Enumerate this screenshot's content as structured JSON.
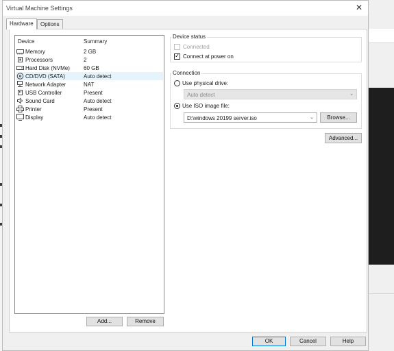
{
  "window": {
    "title": "Virtual Machine Settings",
    "close_glyph": "✕"
  },
  "tabs": [
    {
      "label": "Hardware",
      "active": true
    },
    {
      "label": "Options",
      "active": false
    }
  ],
  "device_table": {
    "columns": [
      "Device",
      "Summary"
    ],
    "rows": [
      {
        "icon": "memory-icon",
        "device": "Memory",
        "summary": "2 GB",
        "selected": false
      },
      {
        "icon": "processor-icon",
        "device": "Processors",
        "summary": "2",
        "selected": false
      },
      {
        "icon": "hard-disk-icon",
        "device": "Hard Disk (NVMe)",
        "summary": "60 GB",
        "selected": false
      },
      {
        "icon": "cd-dvd-icon",
        "device": "CD/DVD (SATA)",
        "summary": "Auto detect",
        "selected": true
      },
      {
        "icon": "network-adapter-icon",
        "device": "Network Adapter",
        "summary": "NAT",
        "selected": false
      },
      {
        "icon": "usb-icon",
        "device": "USB Controller",
        "summary": "Present",
        "selected": false
      },
      {
        "icon": "speaker-icon",
        "device": "Sound Card",
        "summary": "Auto detect",
        "selected": false
      },
      {
        "icon": "printer-icon",
        "device": "Printer",
        "summary": "Present",
        "selected": false
      },
      {
        "icon": "monitor-icon",
        "device": "Display",
        "summary": "Auto detect",
        "selected": false
      }
    ]
  },
  "list_buttons": {
    "add": "Add...",
    "remove": "Remove"
  },
  "device_status": {
    "title": "Device status",
    "connected": {
      "label": "Connected",
      "checked": false,
      "enabled": false
    },
    "connect_at_power_on": {
      "label": "Connect at power on",
      "checked": true,
      "enabled": true
    }
  },
  "connection": {
    "title": "Connection",
    "physical_drive": {
      "label": "Use physical drive:",
      "selected": false,
      "value": "Auto detect"
    },
    "iso_image": {
      "label": "Use ISO image file:",
      "selected": true,
      "value": "D:\\windows 20199 server.iso"
    },
    "browse": "Browse...",
    "advanced": "Advanced..."
  },
  "footer": {
    "ok": "OK",
    "cancel": "Cancel",
    "help": "Help"
  },
  "colors": {
    "accent": "#0078d7",
    "selection": "#e5f3fb",
    "dialog_bg": "#f0f0f0"
  }
}
